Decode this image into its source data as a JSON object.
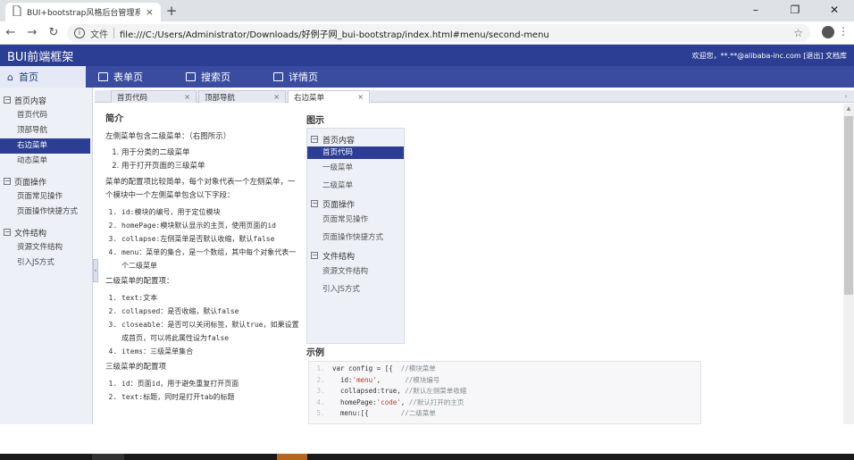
{
  "browser": {
    "tab_title": "BUI+bootstrap风格后台管理系统",
    "url_label": "文件",
    "url": "file:///C:/Users/Administrator/Downloads/好例子网_bui-bootstrap/index.html#menu/second-menu"
  },
  "header": {
    "brand": "BUI前端框架",
    "user_info": "欢迎您，**.**@alibaba-inc.com [退出] 文档库"
  },
  "menubar": {
    "items": [
      "首页",
      "表单页",
      "搜索页",
      "详情页"
    ]
  },
  "sidebar": {
    "groups": [
      {
        "title": "首页内容",
        "items": [
          "首页代码",
          "顶部导航",
          "右边菜单",
          "动态菜单"
        ]
      },
      {
        "title": "页面操作",
        "items": [
          "页面常见操作",
          "页面操作快捷方式"
        ]
      },
      {
        "title": "文件结构",
        "items": [
          "资源文件结构",
          "引入JS方式"
        ]
      }
    ],
    "selected": "右边菜单"
  },
  "tabs": {
    "items": [
      "首页代码",
      "顶部导航",
      "右边菜单"
    ]
  },
  "content": {
    "intro_title": "简介",
    "intro_p1": "左侧菜单包含二级菜单：（右图所示）",
    "intro_list1": [
      "用于分类的二级菜单",
      "用于打开页面的三级菜单"
    ],
    "intro_p2": "菜单的配置项比较简单，每个对象代表一个左侧菜单，一个模块中一个左侧菜单包含以下字段：",
    "intro_list2": [
      "id:模块的编号，用于定位模块",
      "homePage:模块默认显示的主页，使用页面的id",
      "collapse:左侧菜单是否默认收缩，默认false",
      "menu：菜单的集合，是一个数组，其中每个对象代表一个二级菜单"
    ],
    "intro_p3": "二级菜单的配置项：",
    "intro_list3": [
      "text:文本",
      "collapsed：是否收缩，默认false",
      "closeable：是否可以关闭标签，默认true，如果设置成首页，可以将此属性设为false",
      "items：三级菜单集合"
    ],
    "intro_p4": "三级菜单的配置项",
    "intro_list4": [
      "id：页面id，用于避免重复打开页面",
      "text:标题，同时是打开tab的标题"
    ],
    "figure_title": "图示",
    "figure_groups": [
      {
        "title": "首页内容",
        "items": [
          "首页代码",
          "一级菜单",
          "二级菜单"
        ]
      },
      {
        "title": "页面操作",
        "items": [
          "页面常见操作",
          "页面操作快捷方式"
        ]
      },
      {
        "title": "文件结构",
        "items": [
          "资源文件结构",
          "引入JS方式"
        ]
      }
    ],
    "example_title": "示例",
    "code_lines": [
      {
        "n": "1.",
        "code": "var config = [{  ",
        "comment": "//模块菜单"
      },
      {
        "n": "2.",
        "code": "  id:",
        "str": "'menu'",
        "code2": ",      ",
        "comment": "//模块编号"
      },
      {
        "n": "3.",
        "code": "  collapsed:true, ",
        "comment": "//默认左侧菜单收缩"
      },
      {
        "n": "4.",
        "code": "  homePage:",
        "str": "'code'",
        "code2": ", ",
        "comment": "//默认打开的主页"
      },
      {
        "n": "5.",
        "code": "  menu:[{        ",
        "comment": "//二级菜单"
      }
    ]
  }
}
